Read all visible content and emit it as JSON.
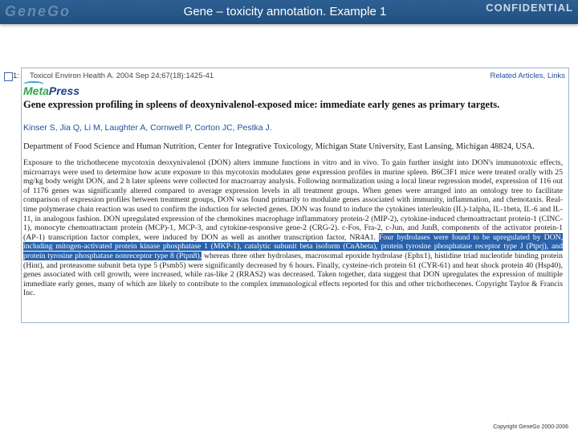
{
  "header": {
    "logo_text": "GeneGo",
    "title": "Gene – toxicity annotation. Example 1",
    "confidential": "CONFIDENTIAL"
  },
  "citation": {
    "number": "1:",
    "text": "Toxicol Environ Health A. 2004 Sep 24;67(18):1425-41",
    "related": "Related Articles, Links"
  },
  "publisher": {
    "meta": "Meta",
    "press": "Press"
  },
  "article": {
    "title": "Gene expression profiling in spleens of deoxynivalenol-exposed mice: immediate early genes as primary targets.",
    "authors": "Kinser S, Jia Q, Li M, Laughter A, Cornwell P, Corton JC, Pestka J.",
    "affiliation": "Department of Food Science and Human Nutrition, Center for Integrative Toxicology, Michigan State University, East Lansing, Michigan 48824, USA."
  },
  "abstract": {
    "before": "Exposure to the trichothecene mycotoxin deoxynivalenol (DON) alters immune functions in vitro and in vivo. To gain further insight into DON's immunotoxic effects, microarrays were used to determine how acute exposure to this mycotoxin modulates gene expression profiles in murine spleen. B6C3F1 mice were treated orally with 25 mg/kg body weight DON, and 2 h later spleens were collected for macroarray analysis. Following normalization using a local linear regression model, expression of 116 out of 1176 genes was significantly altered compared to average expression levels in all treatment groups. When genes were arranged into an ontology tree to facilitate comparison of expression profiles between treatment groups, DON was found primarily to modulate genes associated with immunity, inflammation, and chemotaxis. Real-time polymerase chain reaction was used to confirm the induction for selected genes. DON was found to induce the cytokines interleukin (IL)-1alpha, IL-1beta, IL-6 and IL-11, in analogous fashion. DON upregulated expression of the chemokines macrophage inflammatory protein-2 (MIP-2), cytokine-induced chemoattractant protein-1 (CINC-1), monocyte chemoattractant protein (MCP)-1, MCP-3, and cytokine-responsive gene-2 (CRG-2). c-Fos, Fra-2, c-Jun, and JunB, components of the activator protein-1 (AP-1) transcription factor complex, were induced by DON as well as another transcription factor, NR4A1. ",
    "highlight": "Four hydrolases were found to be upregulated by DON, including mitogen-activated protein kinase phosphatase 1 (MKP-1), catalytic subunit beta isoform (CnAbeta), protein tyrosine phosphatase receptor type J (Ptprj), and protein tyrosine phosphatase nonreceptor type 8 (Ptpn8),",
    "after": " whereas three other hydrolases, macrosomal epoxide hydrolase (Ephx1), histidine triad nucleotide binding protein (Hint), and proteasome subunit beta type 5 (Psmb5) were significantly decreased by 6 hours. Finally, cysteine-rich protein 61 (CYR-61) and heat shock protein 40 (Hsp40), genes associated with cell growth, were increased, while ras-like 2 (RRAS2) was decreased. Taken together, data suggest that DON upregulates the expression of multiple immediate early genes, many of which are likely to contribute to the complex immunological effects reported for this and other trichothecenes. Copyright Taylor & Francis Inc."
  },
  "footer": {
    "copyright": "Copyright GeneGo 2000-2006"
  }
}
